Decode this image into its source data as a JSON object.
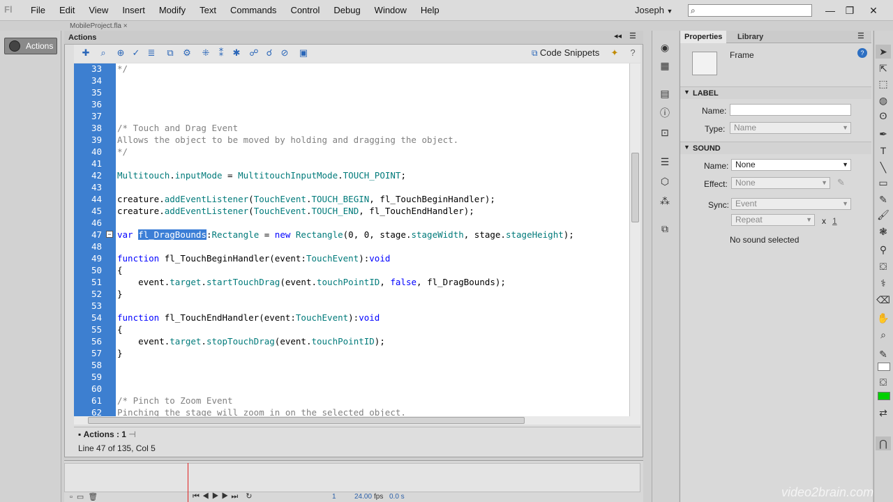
{
  "menubar": {
    "logo": "Fl",
    "items": [
      "File",
      "Edit",
      "View",
      "Insert",
      "Modify",
      "Text",
      "Commands",
      "Control",
      "Debug",
      "Window",
      "Help"
    ],
    "user": "Joseph"
  },
  "window_controls": {
    "minimize": "—",
    "restore": "❐",
    "close": "✕"
  },
  "left": {
    "doc_tab": "MobileProject.fla ×",
    "actions_button": "Actions"
  },
  "actions_panel": {
    "title": "Actions",
    "code_snippets": "Code Snippets",
    "footer_tab": "Actions : 1",
    "status": "Line 47 of 135, Col 5"
  },
  "code": {
    "lines": [
      {
        "n": "33",
        "t": "*/",
        "c": "cmt"
      },
      {
        "n": "34",
        "t": ""
      },
      {
        "n": "35",
        "t": ""
      },
      {
        "n": "36",
        "t": ""
      },
      {
        "n": "37",
        "t": ""
      },
      {
        "n": "38",
        "t": "/* Touch and Drag Event",
        "c": "cmt"
      },
      {
        "n": "39",
        "t": "Allows the object to be moved by holding and dragging the object.",
        "c": "cmt"
      },
      {
        "n": "40",
        "t": "*/",
        "c": "cmt"
      },
      {
        "n": "41",
        "t": ""
      },
      {
        "n": "42",
        "t": "Multitouch.inputMode = MultitouchInputMode.TOUCH_POINT;"
      },
      {
        "n": "43",
        "t": ""
      },
      {
        "n": "44",
        "t": "creature.addEventListener(TouchEvent.TOUCH_BEGIN, fl_TouchBeginHandler);"
      },
      {
        "n": "45",
        "t": "creature.addEventListener(TouchEvent.TOUCH_END, fl_TouchEndHandler);"
      },
      {
        "n": "46",
        "t": ""
      },
      {
        "n": "47",
        "t": "var fl_DragBounds:Rectangle = new Rectangle(0, 0, stage.stageWidth, stage.stageHeight);"
      },
      {
        "n": "48",
        "t": ""
      },
      {
        "n": "49",
        "t": "function fl_TouchBeginHandler(event:TouchEvent):void"
      },
      {
        "n": "50",
        "t": "{"
      },
      {
        "n": "51",
        "t": "    event.target.startTouchDrag(event.touchPointID, false, fl_DragBounds);"
      },
      {
        "n": "52",
        "t": "}"
      },
      {
        "n": "53",
        "t": ""
      },
      {
        "n": "54",
        "t": "function fl_TouchEndHandler(event:TouchEvent):void"
      },
      {
        "n": "55",
        "t": "{"
      },
      {
        "n": "56",
        "t": "    event.target.stopTouchDrag(event.touchPointID);"
      },
      {
        "n": "57",
        "t": "}"
      },
      {
        "n": "58",
        "t": ""
      },
      {
        "n": "59",
        "t": ""
      },
      {
        "n": "60",
        "t": ""
      },
      {
        "n": "61",
        "t": "/* Pinch to Zoom Event",
        "c": "cmt"
      },
      {
        "n": "62",
        "t": "Pinching the stage will zoom in on the selected object.",
        "c": "cmt"
      }
    ],
    "selected_text": "fl_DragBounds"
  },
  "properties": {
    "tabs": [
      "Properties",
      "Library"
    ],
    "object": "Frame",
    "label_section": "LABEL",
    "name_label": "Name:",
    "name_value": "",
    "type_label": "Type:",
    "type_value": "Name",
    "sound_section": "SOUND",
    "snd_name_label": "Name:",
    "snd_name_value": "None",
    "effect_label": "Effect:",
    "effect_value": "None",
    "sync_label": "Sync:",
    "sync_value": "Event",
    "repeat_value": "Repeat",
    "repeat_x": "x",
    "repeat_count": "1",
    "no_sound": "No sound selected"
  },
  "timeline": {
    "frame": "1",
    "fps": "24.00",
    "fps_unit": "fps",
    "time": "0.0 s"
  },
  "watermark": "video2brain.com"
}
